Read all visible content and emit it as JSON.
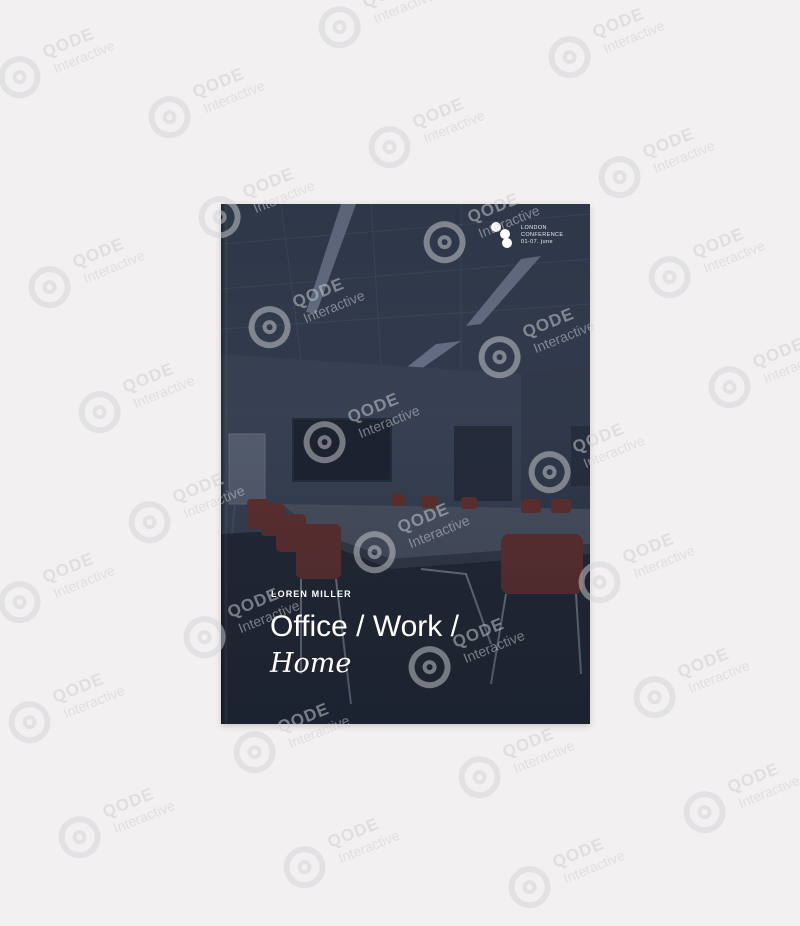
{
  "cover": {
    "author": "LOREN MILLER",
    "title_line1": "Office / Work /",
    "title_line2": "Home",
    "conference": {
      "line1": "LONDON",
      "line2": "CONFERENCE",
      "line3": "01-07. june"
    }
  },
  "watermark": {
    "name": "QODE",
    "sub": "Interactive"
  },
  "colors": {
    "background": "#f3f0f1",
    "cover_base": "#2a3240",
    "chair_red": "#8a3a33",
    "text": "#ffffff"
  }
}
